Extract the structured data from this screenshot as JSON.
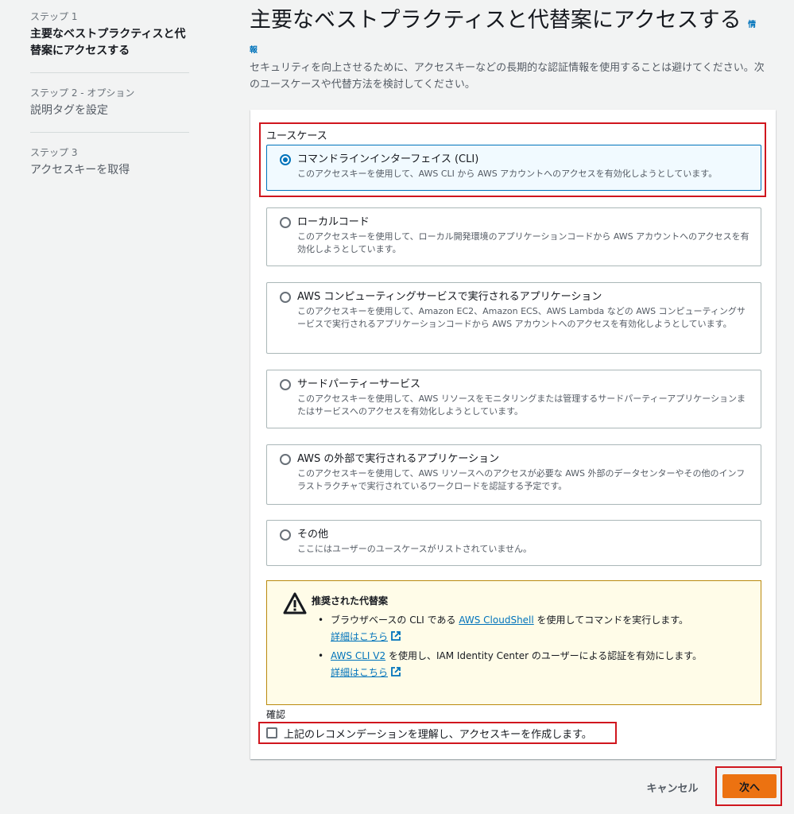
{
  "sidebar": {
    "steps": [
      {
        "label": "ステップ 1",
        "title": "主要なベストプラクティスと代替案にアクセスする"
      },
      {
        "label": "ステップ 2 - オプション",
        "title": "説明タグを設定"
      },
      {
        "label": "ステップ 3",
        "title": "アクセスキーを取得"
      }
    ]
  },
  "header": {
    "title": "主要なベストプラクティスと代替案にアクセスする",
    "info_part1": "情",
    "info_part2": "報",
    "description": "セキュリティを向上させるために、アクセスキーなどの長期的な認証情報を使用することは避けてください。次のユースケースや代替方法を検討してください。"
  },
  "use_case": {
    "section_label": "ユースケース",
    "selected": "コマンドラインインターフェイス (CLI)",
    "options": [
      {
        "title": "コマンドラインインターフェイス (CLI)",
        "desc": "このアクセスキーを使用して、AWS CLI から AWS アカウントへのアクセスを有効化しようとしています。"
      },
      {
        "title": "ローカルコード",
        "desc": "このアクセスキーを使用して、ローカル開発環境のアプリケーションコードから AWS アカウントへのアクセスを有効化しようとしています。"
      },
      {
        "title": "AWS コンピューティングサービスで実行されるアプリケーション",
        "desc": "このアクセスキーを使用して、Amazon EC2、Amazon ECS、AWS Lambda などの AWS コンピューティングサービスで実行されるアプリケーションコードから AWS アカウントへのアクセスを有効化しようとしています。"
      },
      {
        "title": "サードパーティーサービス",
        "desc": "このアクセスキーを使用して、AWS リソースをモニタリングまたは管理するサードパーティーアプリケーションまたはサービスへのアクセスを有効化しようとしています。"
      },
      {
        "title": "AWS の外部で実行されるアプリケーション",
        "desc": "このアクセスキーを使用して、AWS リソースへのアクセスが必要な AWS 外部のデータセンターやその他のインフラストラクチャで実行されているワークロードを認証する予定です。"
      },
      {
        "title": "その他",
        "desc": "ここにはユーザーのユースケースがリストされていません。"
      }
    ]
  },
  "alert": {
    "title": "推奨された代替案",
    "item1_pre": "ブラウザベースの CLI である ",
    "item1_link": "AWS CloudShell",
    "item1_post": " を使用してコマンドを実行します。",
    "item1_more": "詳細はこちら",
    "item2_link": "AWS CLI V2",
    "item2_post": " を使用し、IAM Identity Center のユーザーによる認証を有効にします。",
    "item2_more": "詳細はこちら"
  },
  "confirmation": {
    "label": "確認",
    "checkbox_label": "上記のレコメンデーションを理解し、アクセスキーを作成します。",
    "checked": false
  },
  "footer": {
    "cancel_label": "キャンセル",
    "next_label": "次へ"
  },
  "colors": {
    "accent": "#0073bb",
    "primary_button": "#ec7211",
    "highlight": "#d0161e",
    "warning_bg": "#fffce8"
  }
}
